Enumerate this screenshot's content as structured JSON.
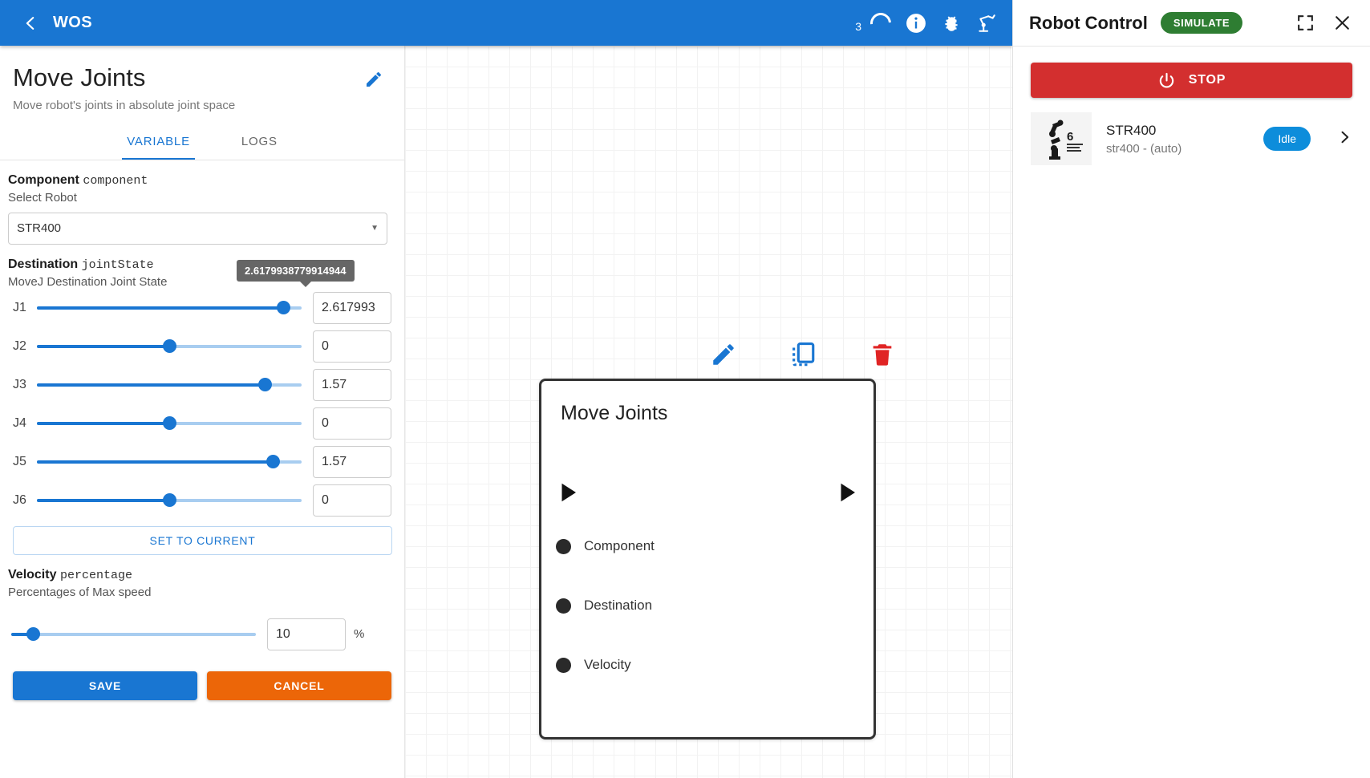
{
  "topbar": {
    "app_name": "WOS",
    "back_icon": "chevron-left-icon",
    "notification_count": "3",
    "icons": [
      "loading-spinner-icon",
      "info-icon",
      "bug-icon",
      "robot-arm-icon"
    ]
  },
  "panel": {
    "title": "Move Joints",
    "subtitle": "Move robot's joints in absolute joint space",
    "edit_icon": "pencil-icon",
    "tabs": [
      {
        "label": "VARIABLE",
        "active": true
      },
      {
        "label": "LOGS",
        "active": false
      }
    ],
    "component_field": {
      "label": "Component",
      "type_hint": "component",
      "description": "Select Robot",
      "selected": "STR400"
    },
    "destination_field": {
      "label": "Destination",
      "type_hint": "jointState",
      "description": "MoveJ Destination Joint State",
      "tooltip_value": "2.6179938779914944",
      "joints": [
        {
          "name": "J1",
          "value": "2.617993",
          "percent": 93
        },
        {
          "name": "J2",
          "value": "0",
          "percent": 50
        },
        {
          "name": "J3",
          "value": "1.57",
          "percent": 86
        },
        {
          "name": "J4",
          "value": "0",
          "percent": 50
        },
        {
          "name": "J5",
          "value": "1.57",
          "percent": 89
        },
        {
          "name": "J6",
          "value": "0",
          "percent": 50
        }
      ],
      "set_current_label": "SET TO CURRENT"
    },
    "velocity_field": {
      "label": "Velocity",
      "type_hint": "percentage",
      "description": "Percentages of Max speed",
      "value": "10",
      "percent": 9,
      "unit": "%"
    },
    "save_label": "SAVE",
    "cancel_label": "CANCEL"
  },
  "canvas": {
    "tools": [
      {
        "name": "edit-icon",
        "color": "#1976d2"
      },
      {
        "name": "duplicate-icon",
        "color": "#1976d2"
      },
      {
        "name": "delete-icon",
        "color": "#e02424"
      }
    ],
    "node": {
      "title": "Move Joints",
      "ports": [
        "Component",
        "Destination",
        "Velocity"
      ]
    }
  },
  "robot_control": {
    "title": "Robot Control",
    "mode_label": "SIMULATE",
    "fullscreen_icon": "fullscreen-icon",
    "close_icon": "close-icon",
    "stop_label": "STOP",
    "power_icon": "power-icon",
    "robot": {
      "name": "STR400",
      "id": "str400 - (auto)",
      "status": "Idle",
      "thumb_label": "6",
      "chevron_icon": "chevron-right-icon"
    }
  },
  "colors": {
    "primary": "#1976d2",
    "danger": "#d32f2f",
    "warning": "#ec6608",
    "success": "#2e7d32",
    "status": "#0d8ddb"
  }
}
